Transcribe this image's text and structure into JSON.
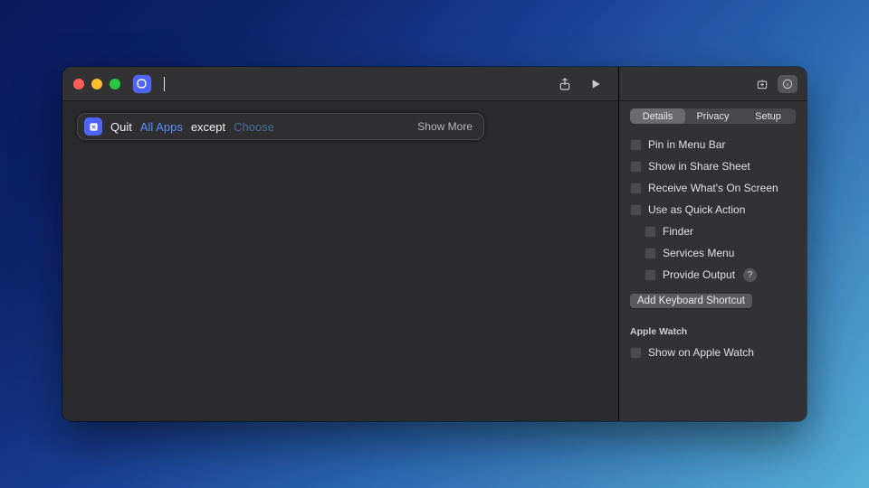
{
  "toolbar": {
    "share_icon": "share-icon",
    "play_icon": "play-icon",
    "new_icon": "new-window-icon",
    "info_icon": "info-icon"
  },
  "action": {
    "quit": "Quit",
    "all_apps": "All Apps",
    "except": "except",
    "choose": "Choose",
    "show_more": "Show More"
  },
  "tabs": {
    "details": "Details",
    "privacy": "Privacy",
    "setup": "Setup"
  },
  "settings": {
    "pin_menu_bar": "Pin in Menu Bar",
    "share_sheet": "Show in Share Sheet",
    "receive_screen": "Receive What's On Screen",
    "quick_action": "Use as Quick Action",
    "finder": "Finder",
    "services_menu": "Services Menu",
    "provide_output": "Provide Output",
    "help_glyph": "?",
    "add_shortcut": "Add Keyboard Shortcut",
    "apple_watch_section": "Apple Watch",
    "show_apple_watch": "Show on Apple Watch"
  }
}
